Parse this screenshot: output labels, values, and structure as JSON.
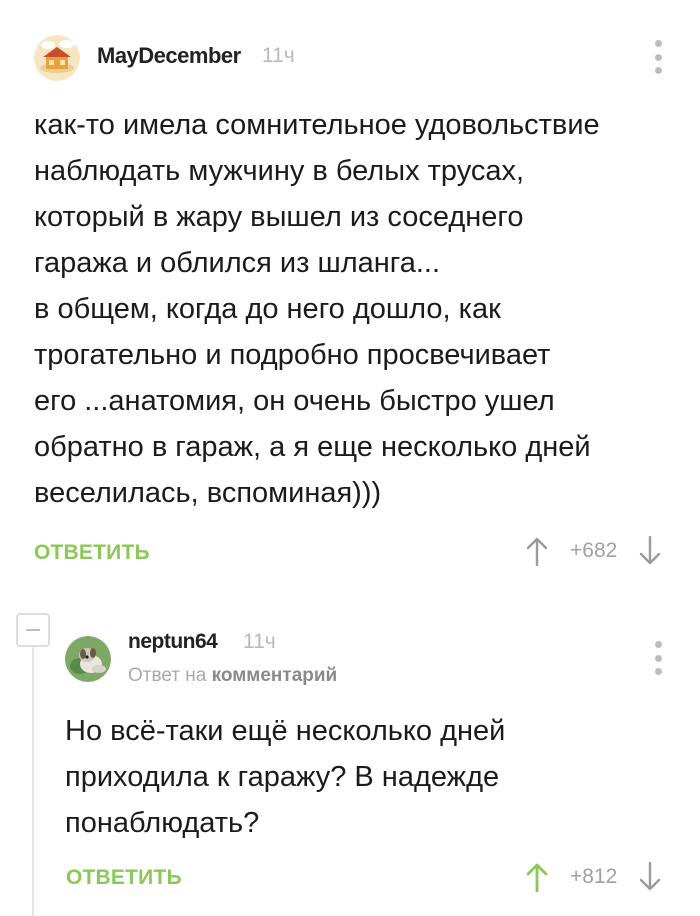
{
  "comments": [
    {
      "username": "MayDecember",
      "time": "11ч",
      "avatar_icon": "cottage-avatar-icon",
      "text": "как-то имела сомнительное удовольствие\nнаблюдать мужчину в белых трусах,\nкоторый в жару вышел из соседнего\nгаража и облился из шланга...\nв общем, когда до него дошло, как\nтрогательно и подробно просвечивает\nего ...анатомия, он очень быстро ушел\nобратно в гараж, а я еще несколько дней\nвеселилась, вспоминая)))",
      "reply_label": "ОТВЕТИТЬ",
      "rating": "+682",
      "upvote_state": "neutral"
    },
    {
      "username": "neptun64",
      "time": "11ч",
      "avatar_icon": "dog-avatar-icon",
      "reply_prefix": "Ответ на",
      "reply_target": "комментарий",
      "text": "Но всё-таки ещё несколько дней\nприходила к гаражу? В надежде\nпонаблюдать?",
      "reply_label": "ОТВЕТИТЬ",
      "rating": "+812",
      "upvote_state": "upvoted"
    }
  ],
  "colors": {
    "accent_green": "#8ac858",
    "muted_gray": "#a0a0a0",
    "upvoted": "#8ac858"
  }
}
